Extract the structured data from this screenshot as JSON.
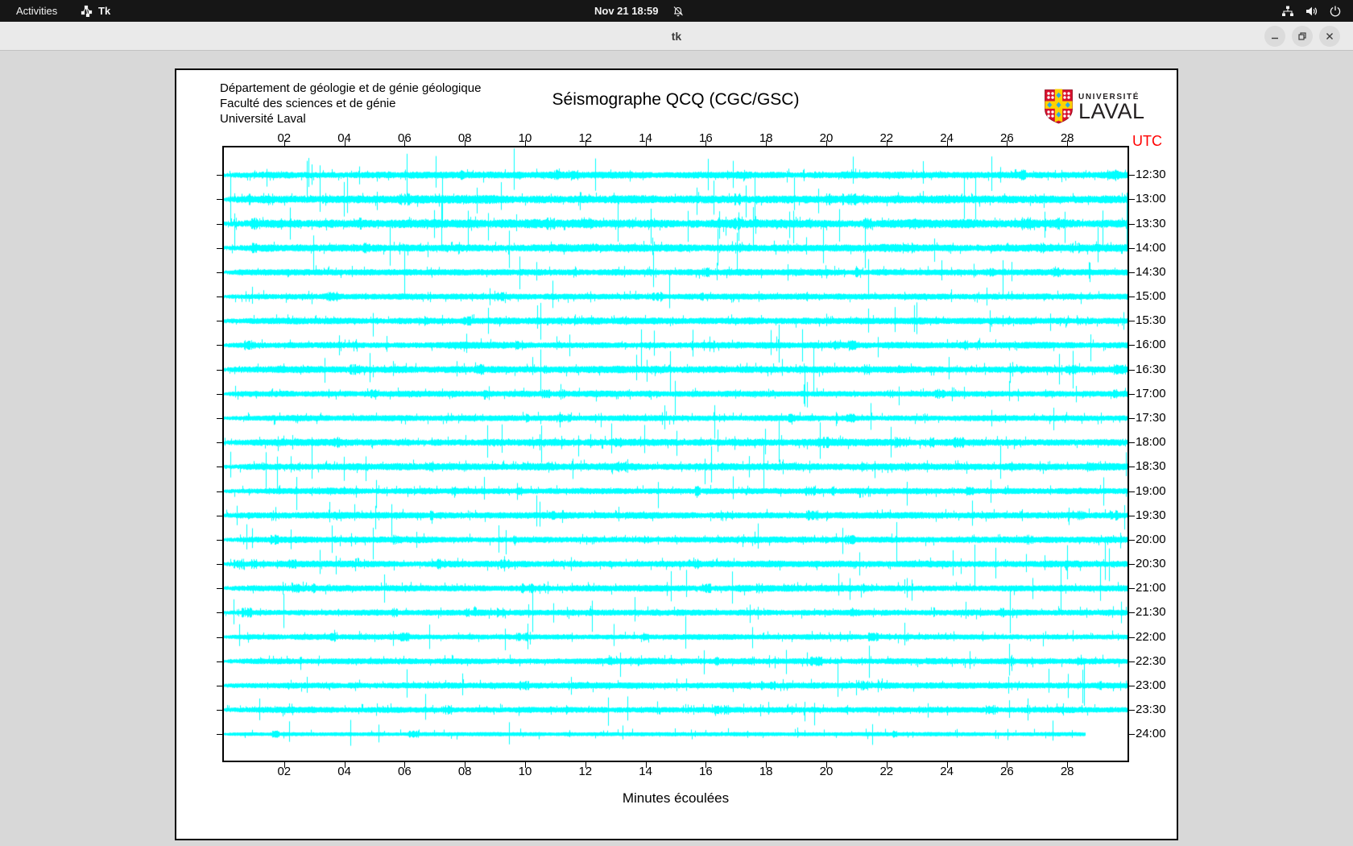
{
  "topbar": {
    "activities_label": "Activities",
    "app_name": "Tk",
    "clock": "Nov 21 18:59",
    "icons": [
      "tk-app-icon",
      "notifications-off-icon",
      "network-wired-icon",
      "volume-icon",
      "power-icon"
    ]
  },
  "titlebar": {
    "title": "tk",
    "buttons": [
      "minimize",
      "restore",
      "close"
    ]
  },
  "header": {
    "lines": [
      "Département de géologie et de génie géologique",
      "Faculté des sciences et de génie",
      "Université Laval"
    ],
    "logo_small": "UNIVERSITÉ",
    "logo_big": "LAVAL"
  },
  "chart_data": {
    "type": "line",
    "subtype": "seismogram-helicorder",
    "title": "Séismographe QCQ (CGC/GSC)",
    "xlabel": "Minutes écoulées",
    "y_axis_label": "UTC",
    "x_range": [
      0,
      30
    ],
    "x_ticks": [
      "02",
      "04",
      "06",
      "08",
      "10",
      "12",
      "14",
      "16",
      "18",
      "20",
      "22",
      "24",
      "26",
      "28"
    ],
    "grid": false,
    "trace_color": "#00ffff",
    "utc_label_color": "#ff0000",
    "rows": [
      {
        "utc": "12:30",
        "end_minute": 30,
        "activity": 0.95
      },
      {
        "utc": "13:00",
        "end_minute": 30,
        "activity": 1.2
      },
      {
        "utc": "13:30",
        "end_minute": 30,
        "activity": 1.25
      },
      {
        "utc": "14:00",
        "end_minute": 30,
        "activity": 1.05
      },
      {
        "utc": "14:30",
        "end_minute": 30,
        "activity": 0.85
      },
      {
        "utc": "15:00",
        "end_minute": 30,
        "activity": 0.8
      },
      {
        "utc": "15:30",
        "end_minute": 30,
        "activity": 0.9
      },
      {
        "utc": "16:00",
        "end_minute": 30,
        "activity": 0.85
      },
      {
        "utc": "16:30",
        "end_minute": 30,
        "activity": 1.0
      },
      {
        "utc": "17:00",
        "end_minute": 30,
        "activity": 0.8
      },
      {
        "utc": "17:30",
        "end_minute": 30,
        "activity": 0.75
      },
      {
        "utc": "18:00",
        "end_minute": 30,
        "activity": 1.0
      },
      {
        "utc": "18:30",
        "end_minute": 30,
        "activity": 1.0
      },
      {
        "utc": "19:00",
        "end_minute": 30,
        "activity": 0.8
      },
      {
        "utc": "19:30",
        "end_minute": 30,
        "activity": 0.9
      },
      {
        "utc": "20:00",
        "end_minute": 30,
        "activity": 0.85
      },
      {
        "utc": "20:30",
        "end_minute": 30,
        "activity": 0.9
      },
      {
        "utc": "21:00",
        "end_minute": 30,
        "activity": 0.9
      },
      {
        "utc": "21:30",
        "end_minute": 30,
        "activity": 0.8
      },
      {
        "utc": "22:00",
        "end_minute": 30,
        "activity": 0.7
      },
      {
        "utc": "22:30",
        "end_minute": 30,
        "activity": 0.8
      },
      {
        "utc": "23:00",
        "end_minute": 30,
        "activity": 0.8
      },
      {
        "utc": "23:30",
        "end_minute": 30,
        "activity": 0.8
      },
      {
        "utc": "24:00",
        "end_minute": 28.6,
        "activity": 0.45
      }
    ]
  }
}
